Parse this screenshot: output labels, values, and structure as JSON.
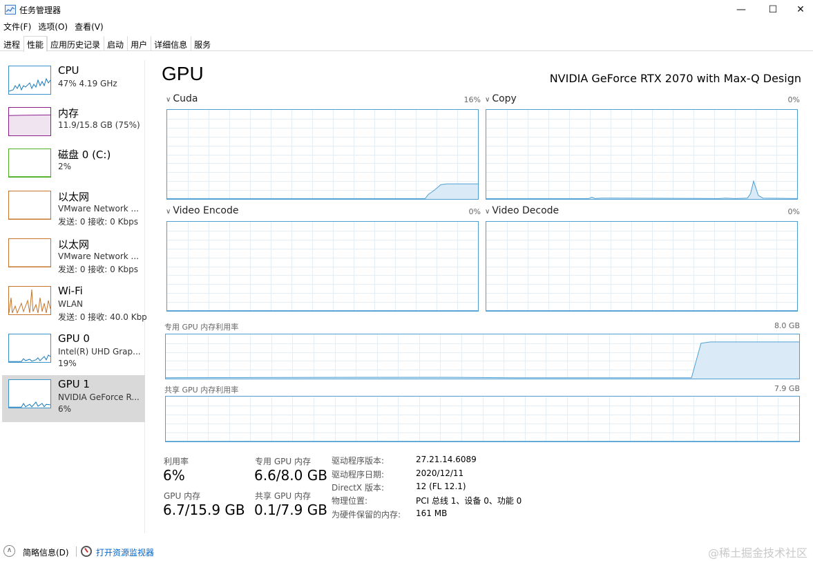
{
  "window": {
    "title": "任务管理器",
    "min_icon": "—",
    "max_icon": "☐",
    "close_icon": "✕"
  },
  "menu": [
    "文件(F)",
    "选项(O)",
    "查看(V)"
  ],
  "tabs": [
    "进程",
    "性能",
    "应用历史记录",
    "启动",
    "用户",
    "详细信息",
    "服务"
  ],
  "active_tab": "性能",
  "sidebar": [
    {
      "name": "CPU",
      "line1": "47% 4.19 GHz",
      "line2": "",
      "color": "#1779ba"
    },
    {
      "name": "内存",
      "line1": "11.9/15.8 GB (75%)",
      "line2": "",
      "color": "#8b1e8b"
    },
    {
      "name": "磁盘 0 (C:)",
      "line1": "2%",
      "line2": "",
      "color": "#4caf20"
    },
    {
      "name": "以太网",
      "line1": "VMware Network ...",
      "line2": "发送: 0 接收: 0 Kbps",
      "color": "#c4752b"
    },
    {
      "name": "以太网",
      "line1": "VMware Network ...",
      "line2": "发送: 0 接收: 0 Kbps",
      "color": "#c4752b"
    },
    {
      "name": "Wi-Fi",
      "line1": "WLAN",
      "line2": "发送: 0 接收: 40.0 Kbp",
      "color": "#c4752b"
    },
    {
      "name": "GPU 0",
      "line1": "Intel(R) UHD Grap...",
      "line2": "19%",
      "color": "#1779ba"
    },
    {
      "name": "GPU 1",
      "line1": "NVIDIA GeForce R...",
      "line2": "6%",
      "color": "#1779ba"
    }
  ],
  "main": {
    "title": "GPU",
    "model": "NVIDIA GeForce RTX 2070 with Max-Q Design",
    "engines": [
      {
        "label": "Cuda",
        "pct": "16%"
      },
      {
        "label": "Copy",
        "pct": "0%"
      },
      {
        "label": "Video Encode",
        "pct": "0%"
      },
      {
        "label": "Video Decode",
        "pct": "0%"
      }
    ],
    "dedicated_label": "专用 GPU 内存利用率",
    "dedicated_max": "8.0 GB",
    "shared_label": "共享 GPU 内存利用率",
    "shared_max": "7.9 GB"
  },
  "stats": {
    "util_label": "利用率",
    "util_value": "6%",
    "gpu_mem_label": "GPU 内存",
    "gpu_mem_value": "6.7/15.9 GB",
    "ded_mem_label": "专用 GPU 内存",
    "ded_mem_value": "6.6/8.0 GB",
    "shared_mem_label": "共享 GPU 内存",
    "shared_mem_value": "0.1/7.9 GB"
  },
  "info": [
    {
      "k": "驱动程序版本:",
      "v": "27.21.14.6089"
    },
    {
      "k": "驱动程序日期:",
      "v": "2020/12/11"
    },
    {
      "k": "DirectX 版本:",
      "v": "12 (FL 12.1)"
    },
    {
      "k": "物理位置:",
      "v": "PCI 总线 1、设备 0、功能 0"
    },
    {
      "k": "为硬件保留的内存:",
      "v": "161 MB"
    }
  ],
  "footer": {
    "summary": "简略信息(D)",
    "link": "打开资源监视器",
    "watermark": "@稀土掘金技术社区"
  },
  "colors": {
    "graph_border": "#4d9fd3",
    "graph_fill": "#dbeaf7",
    "grid": "#e6eef5",
    "link": "#0066cc"
  }
}
